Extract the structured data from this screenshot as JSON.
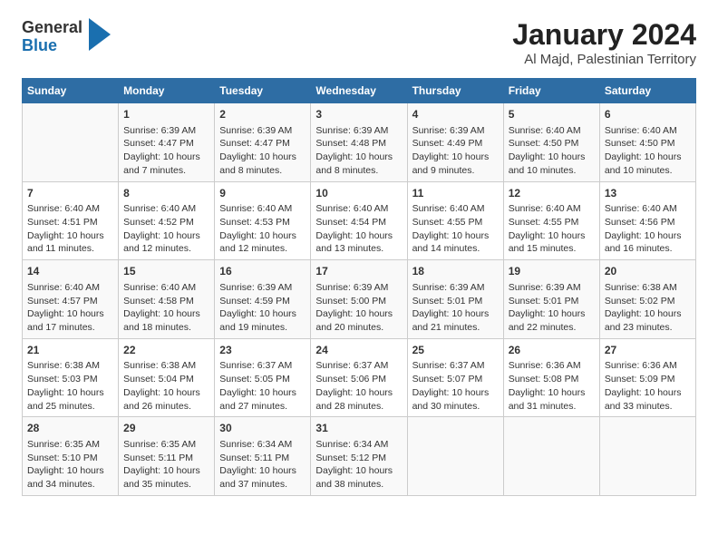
{
  "header": {
    "logo_general": "General",
    "logo_blue": "Blue",
    "title": "January 2024",
    "subtitle": "Al Majd, Palestinian Territory"
  },
  "columns": [
    "Sunday",
    "Monday",
    "Tuesday",
    "Wednesday",
    "Thursday",
    "Friday",
    "Saturday"
  ],
  "rows": [
    [
      {
        "day": "",
        "detail": ""
      },
      {
        "day": "1",
        "detail": "Sunrise: 6:39 AM\nSunset: 4:47 PM\nDaylight: 10 hours\nand 7 minutes."
      },
      {
        "day": "2",
        "detail": "Sunrise: 6:39 AM\nSunset: 4:47 PM\nDaylight: 10 hours\nand 8 minutes."
      },
      {
        "day": "3",
        "detail": "Sunrise: 6:39 AM\nSunset: 4:48 PM\nDaylight: 10 hours\nand 8 minutes."
      },
      {
        "day": "4",
        "detail": "Sunrise: 6:39 AM\nSunset: 4:49 PM\nDaylight: 10 hours\nand 9 minutes."
      },
      {
        "day": "5",
        "detail": "Sunrise: 6:40 AM\nSunset: 4:50 PM\nDaylight: 10 hours\nand 10 minutes."
      },
      {
        "day": "6",
        "detail": "Sunrise: 6:40 AM\nSunset: 4:50 PM\nDaylight: 10 hours\nand 10 minutes."
      }
    ],
    [
      {
        "day": "7",
        "detail": "Sunrise: 6:40 AM\nSunset: 4:51 PM\nDaylight: 10 hours\nand 11 minutes."
      },
      {
        "day": "8",
        "detail": "Sunrise: 6:40 AM\nSunset: 4:52 PM\nDaylight: 10 hours\nand 12 minutes."
      },
      {
        "day": "9",
        "detail": "Sunrise: 6:40 AM\nSunset: 4:53 PM\nDaylight: 10 hours\nand 12 minutes."
      },
      {
        "day": "10",
        "detail": "Sunrise: 6:40 AM\nSunset: 4:54 PM\nDaylight: 10 hours\nand 13 minutes."
      },
      {
        "day": "11",
        "detail": "Sunrise: 6:40 AM\nSunset: 4:55 PM\nDaylight: 10 hours\nand 14 minutes."
      },
      {
        "day": "12",
        "detail": "Sunrise: 6:40 AM\nSunset: 4:55 PM\nDaylight: 10 hours\nand 15 minutes."
      },
      {
        "day": "13",
        "detail": "Sunrise: 6:40 AM\nSunset: 4:56 PM\nDaylight: 10 hours\nand 16 minutes."
      }
    ],
    [
      {
        "day": "14",
        "detail": "Sunrise: 6:40 AM\nSunset: 4:57 PM\nDaylight: 10 hours\nand 17 minutes."
      },
      {
        "day": "15",
        "detail": "Sunrise: 6:40 AM\nSunset: 4:58 PM\nDaylight: 10 hours\nand 18 minutes."
      },
      {
        "day": "16",
        "detail": "Sunrise: 6:39 AM\nSunset: 4:59 PM\nDaylight: 10 hours\nand 19 minutes."
      },
      {
        "day": "17",
        "detail": "Sunrise: 6:39 AM\nSunset: 5:00 PM\nDaylight: 10 hours\nand 20 minutes."
      },
      {
        "day": "18",
        "detail": "Sunrise: 6:39 AM\nSunset: 5:01 PM\nDaylight: 10 hours\nand 21 minutes."
      },
      {
        "day": "19",
        "detail": "Sunrise: 6:39 AM\nSunset: 5:01 PM\nDaylight: 10 hours\nand 22 minutes."
      },
      {
        "day": "20",
        "detail": "Sunrise: 6:38 AM\nSunset: 5:02 PM\nDaylight: 10 hours\nand 23 minutes."
      }
    ],
    [
      {
        "day": "21",
        "detail": "Sunrise: 6:38 AM\nSunset: 5:03 PM\nDaylight: 10 hours\nand 25 minutes."
      },
      {
        "day": "22",
        "detail": "Sunrise: 6:38 AM\nSunset: 5:04 PM\nDaylight: 10 hours\nand 26 minutes."
      },
      {
        "day": "23",
        "detail": "Sunrise: 6:37 AM\nSunset: 5:05 PM\nDaylight: 10 hours\nand 27 minutes."
      },
      {
        "day": "24",
        "detail": "Sunrise: 6:37 AM\nSunset: 5:06 PM\nDaylight: 10 hours\nand 28 minutes."
      },
      {
        "day": "25",
        "detail": "Sunrise: 6:37 AM\nSunset: 5:07 PM\nDaylight: 10 hours\nand 30 minutes."
      },
      {
        "day": "26",
        "detail": "Sunrise: 6:36 AM\nSunset: 5:08 PM\nDaylight: 10 hours\nand 31 minutes."
      },
      {
        "day": "27",
        "detail": "Sunrise: 6:36 AM\nSunset: 5:09 PM\nDaylight: 10 hours\nand 33 minutes."
      }
    ],
    [
      {
        "day": "28",
        "detail": "Sunrise: 6:35 AM\nSunset: 5:10 PM\nDaylight: 10 hours\nand 34 minutes."
      },
      {
        "day": "29",
        "detail": "Sunrise: 6:35 AM\nSunset: 5:11 PM\nDaylight: 10 hours\nand 35 minutes."
      },
      {
        "day": "30",
        "detail": "Sunrise: 6:34 AM\nSunset: 5:11 PM\nDaylight: 10 hours\nand 37 minutes."
      },
      {
        "day": "31",
        "detail": "Sunrise: 6:34 AM\nSunset: 5:12 PM\nDaylight: 10 hours\nand 38 minutes."
      },
      {
        "day": "",
        "detail": ""
      },
      {
        "day": "",
        "detail": ""
      },
      {
        "day": "",
        "detail": ""
      }
    ]
  ]
}
